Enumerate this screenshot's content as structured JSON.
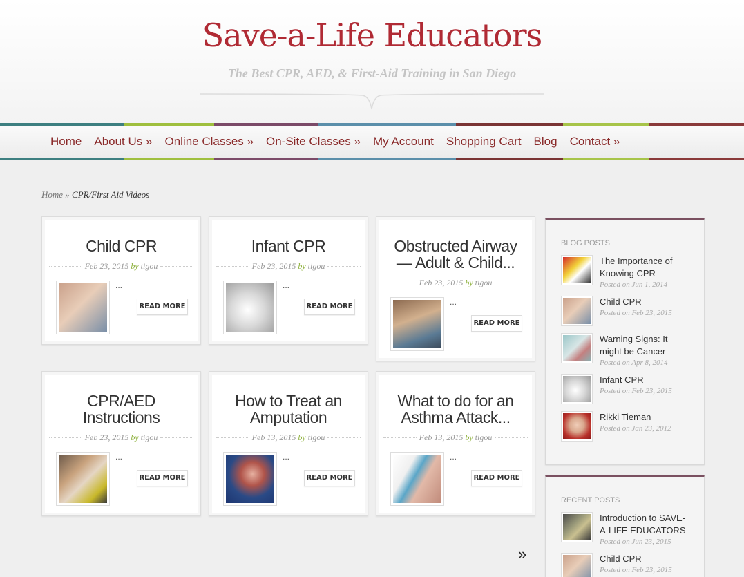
{
  "site": {
    "title": "Save-a-Life Educators",
    "tagline": "The Best CPR, AED, & First-Aid Training in San Diego",
    "brand_color": "#b02a34"
  },
  "nav": {
    "items": [
      {
        "label": "Home"
      },
      {
        "label": "About Us »"
      },
      {
        "label": "Online Classes »"
      },
      {
        "label": "On-Site Classes »"
      },
      {
        "label": "My Account"
      },
      {
        "label": "Shopping Cart"
      },
      {
        "label": "Blog"
      },
      {
        "label": "Contact »"
      }
    ]
  },
  "breadcrumb": {
    "home": "Home",
    "separator": "»",
    "current": "CPR/First Aid Videos"
  },
  "posts": [
    {
      "title": "Child CPR",
      "date": "Feb 23, 2015",
      "by": "by",
      "author": "tigou",
      "excerpt": "...",
      "read_more": "READ MORE"
    },
    {
      "title": "Infant CPR",
      "date": "Feb 23, 2015",
      "by": "by",
      "author": "tigou",
      "excerpt": "...",
      "read_more": "READ MORE"
    },
    {
      "title_line1": "Obstructed Airway",
      "title_line2": "— Adult & Child...",
      "date": "Feb 23, 2015",
      "by": "by",
      "author": "tigou",
      "excerpt": "...",
      "read_more": "READ MORE"
    },
    {
      "title_line1": "CPR/AED",
      "title_line2": "Instructions",
      "date": "Feb 23, 2015",
      "by": "by",
      "author": "tigou",
      "excerpt": "...",
      "read_more": "READ MORE"
    },
    {
      "title_line1": "How to Treat an",
      "title_line2": "Amputation",
      "date": "Feb 13, 2015",
      "by": "by",
      "author": "tigou",
      "excerpt": "...",
      "read_more": "READ MORE"
    },
    {
      "title_line1": "What to do for an",
      "title_line2": "Asthma Attack...",
      "date": "Feb 13, 2015",
      "by": "by",
      "author": "tigou",
      "excerpt": "...",
      "read_more": "READ MORE"
    }
  ],
  "sidebar": {
    "blog_posts": {
      "title": "BLOG POSTS",
      "items": [
        {
          "title_line1": "The Importance of",
          "title_line2": "Knowing CPR",
          "date": "Posted on Jun 1, 2014"
        },
        {
          "title_line1": "Child CPR",
          "date": "Posted on Feb 23, 2015"
        },
        {
          "title_line1": "Warning Signs: It",
          "title_line2": "might be Cancer",
          "date": "Posted on Apr 8, 2014"
        },
        {
          "title_line1": "Infant CPR",
          "date": "Posted on Feb 23, 2015"
        },
        {
          "title_line1": "Rikki Tieman",
          "date": "Posted on Jan 23, 2012"
        }
      ]
    },
    "recent_posts": {
      "title": "RECENT POSTS",
      "items": [
        {
          "title_line1": "Introduction to SAVE-",
          "title_line2": "A-LIFE EDUCATORS",
          "date": "Posted on Jun 23, 2015"
        },
        {
          "title_line1": "Child CPR",
          "date": "Posted on Feb 23, 2015"
        }
      ]
    }
  },
  "pager": {
    "next": "»"
  }
}
